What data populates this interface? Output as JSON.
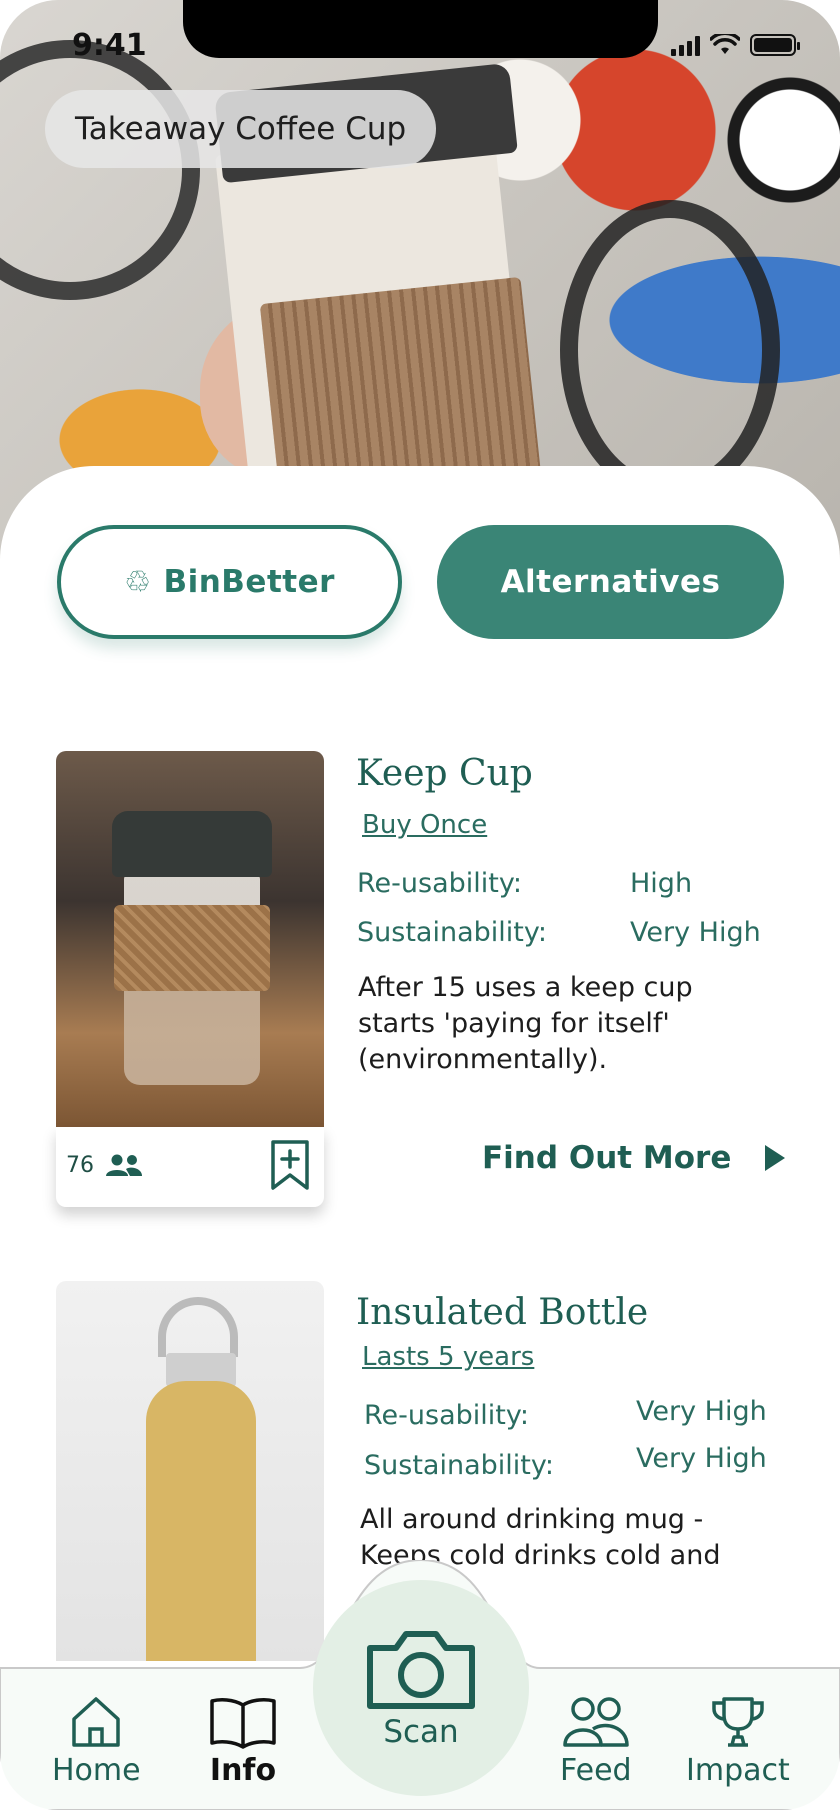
{
  "status_bar": {
    "time": "9:41"
  },
  "header": {
    "item_title": "Takeaway Coffee Cup"
  },
  "tabs": [
    {
      "label": "BinBetter",
      "icon": "recycle-icon",
      "active": false
    },
    {
      "label": "Alternatives",
      "active": true
    }
  ],
  "alternatives": [
    {
      "name": "Keep Cup",
      "tag": "Buy Once",
      "reusability_label": "Re-usability:",
      "reusability": "High",
      "sustainability_label": "Sustainability:",
      "sustainability": "Very High",
      "description": "After 15 uses a keep cup starts 'paying for itself' (environmentally).",
      "likes": "76",
      "cta": "Find Out More"
    },
    {
      "name": "Insulated Bottle",
      "tag": "Lasts 5 years",
      "reusability_label": "Re-usability:",
      "reusability": "Very High",
      "sustainability_label": "Sustainability:",
      "sustainability": "Very High",
      "description": "All around drinking mug - Keeps cold drinks cold and"
    }
  ],
  "nav": {
    "home": "Home",
    "info": "Info",
    "scan": "Scan",
    "feed": "Feed",
    "impact": "Impact"
  },
  "colors": {
    "accent": "#3a8576",
    "accent_dark": "#1f5e53",
    "scan_bg": "#e3efe5"
  }
}
